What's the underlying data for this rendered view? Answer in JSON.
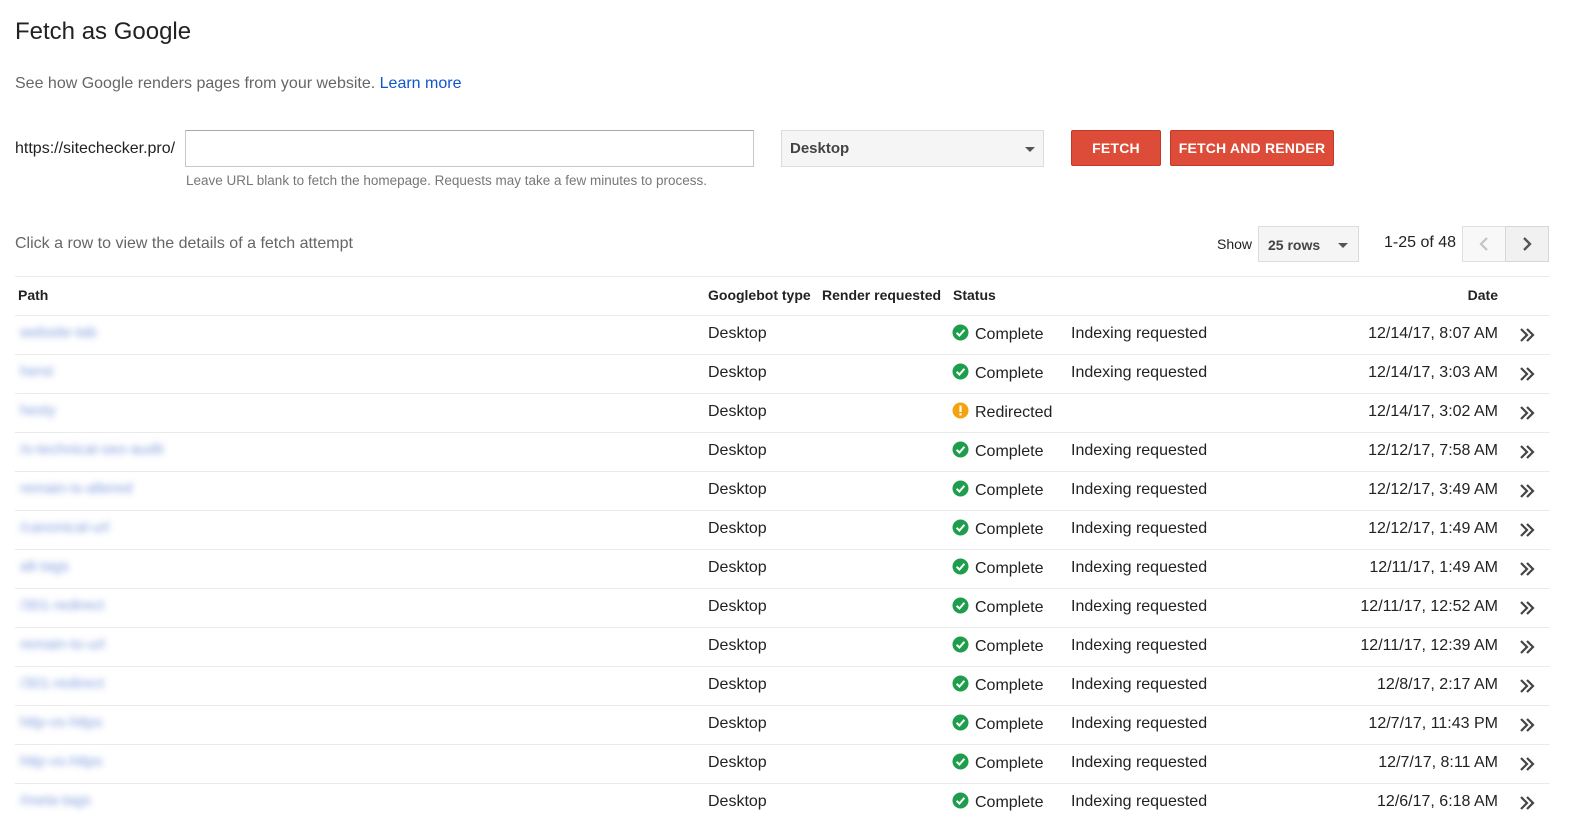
{
  "header": {
    "title": "Fetch as Google",
    "subtitle": "See how Google renders pages from your website.",
    "learn_more": "Learn more"
  },
  "fetch_form": {
    "url_prefix": "https://sitechecker.pro/",
    "url_value": "",
    "hint": "Leave URL blank to fetch the homepage. Requests may take a few minutes to process.",
    "device_selected": "Desktop",
    "fetch_label": "FETCH",
    "fetch_render_label": "FETCH AND RENDER"
  },
  "table_controls": {
    "caption": "Click a row to view the details of a fetch attempt",
    "show_label": "Show",
    "rows_selected": "25 rows",
    "range": "1-25 of 48"
  },
  "table": {
    "columns": {
      "path": "Path",
      "googlebot_type": "Googlebot type",
      "render_requested": "Render requested",
      "status": "Status",
      "date": "Date"
    },
    "rows": [
      {
        "path": "website-tab",
        "type": "Desktop",
        "status": "Complete",
        "status_kind": "complete",
        "indexing": "Indexing requested",
        "date": "12/14/17, 8:07 AM"
      },
      {
        "path": "herst",
        "type": "Desktop",
        "status": "Complete",
        "status_kind": "complete",
        "indexing": "Indexing requested",
        "date": "12/14/17, 3:03 AM"
      },
      {
        "path": "hesty",
        "type": "Desktop",
        "status": "Redirected",
        "status_kind": "redirected",
        "indexing": "",
        "date": "12/14/17, 3:02 AM"
      },
      {
        "path": "/o-technical-seo-audit",
        "type": "Desktop",
        "status": "Complete",
        "status_kind": "complete",
        "indexing": "Indexing requested",
        "date": "12/12/17, 7:58 AM"
      },
      {
        "path": "remain-is-altered",
        "type": "Desktop",
        "status": "Complete",
        "status_kind": "complete",
        "indexing": "Indexing requested",
        "date": "12/12/17, 3:49 AM"
      },
      {
        "path": "/canonical-url",
        "type": "Desktop",
        "status": "Complete",
        "status_kind": "complete",
        "indexing": "Indexing requested",
        "date": "12/12/17, 1:49 AM"
      },
      {
        "path": "alt-tags",
        "type": "Desktop",
        "status": "Complete",
        "status_kind": "complete",
        "indexing": "Indexing requested",
        "date": "12/11/17, 1:49 AM"
      },
      {
        "path": "/301-redirect",
        "type": "Desktop",
        "status": "Complete",
        "status_kind": "complete",
        "indexing": "Indexing requested",
        "date": "12/11/17, 12:52 AM"
      },
      {
        "path": "remain-to-url",
        "type": "Desktop",
        "status": "Complete",
        "status_kind": "complete",
        "indexing": "Indexing requested",
        "date": "12/11/17, 12:39 AM"
      },
      {
        "path": "/301-redirect",
        "type": "Desktop",
        "status": "Complete",
        "status_kind": "complete",
        "indexing": "Indexing requested",
        "date": "12/8/17, 2:17 AM"
      },
      {
        "path": "http-vs-https",
        "type": "Desktop",
        "status": "Complete",
        "status_kind": "complete",
        "indexing": "Indexing requested",
        "date": "12/7/17, 11:43 PM"
      },
      {
        "path": "http-vs-https",
        "type": "Desktop",
        "status": "Complete",
        "status_kind": "complete",
        "indexing": "Indexing requested",
        "date": "12/7/17, 8:11 AM"
      },
      {
        "path": "/meta-tags",
        "type": "Desktop",
        "status": "Complete",
        "status_kind": "complete",
        "indexing": "Indexing requested",
        "date": "12/6/17, 6:18 AM"
      }
    ]
  },
  "colors": {
    "accent_red": "#dd4b39",
    "link_blue": "#1155cc",
    "complete_green": "#1e9e4c",
    "redirect_orange": "#f4a20e"
  },
  "icons": {
    "complete": "check-circle-icon",
    "redirected": "exclamation-circle-icon",
    "row_open": "double-chevron-right-icon",
    "prev": "chevron-left-icon",
    "next": "chevron-right-icon",
    "dropdown": "caret-down-icon"
  }
}
